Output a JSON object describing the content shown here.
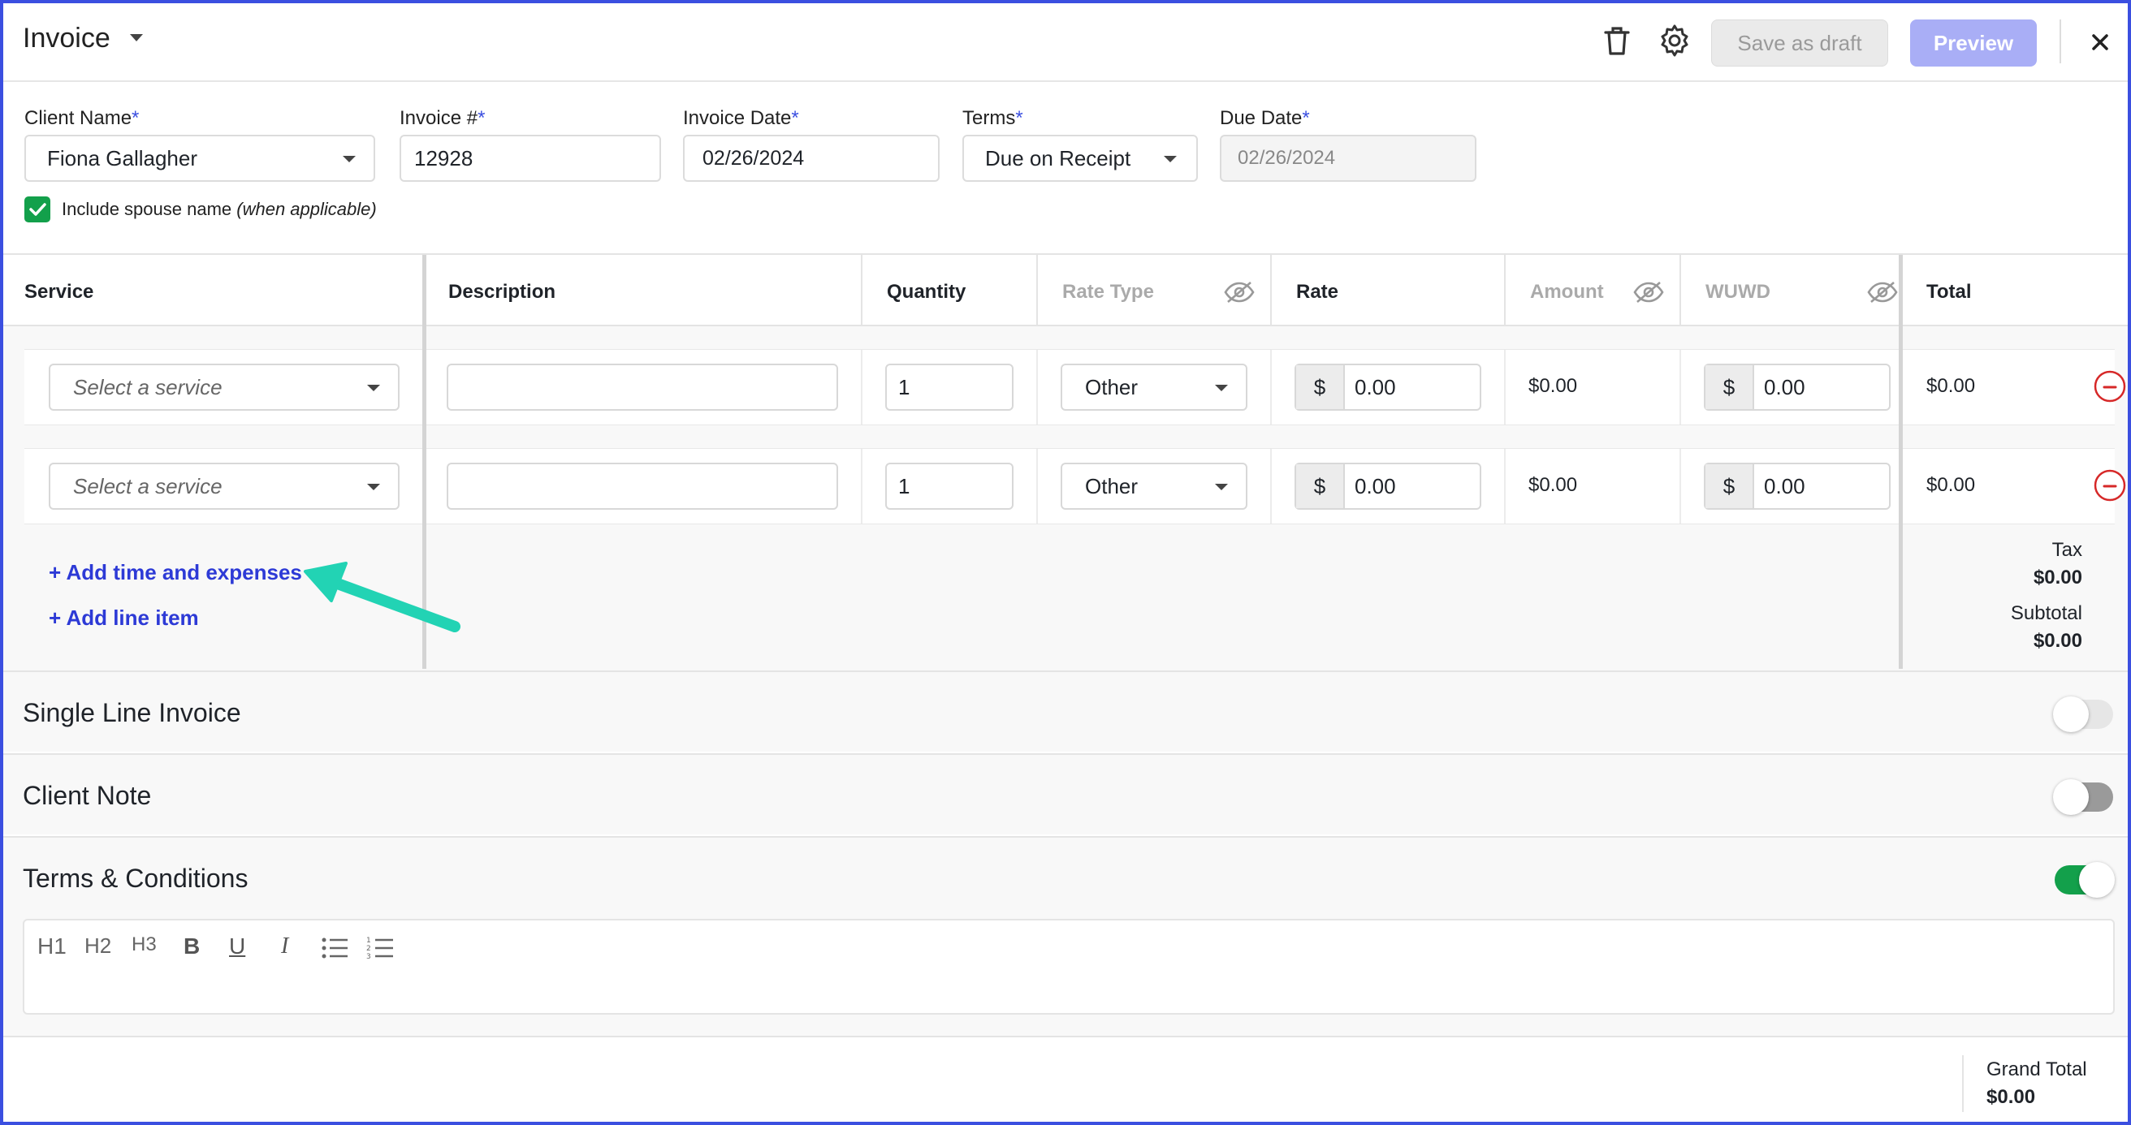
{
  "header": {
    "title": "Invoice",
    "save_draft_label": "Save as draft",
    "preview_label": "Preview",
    "icons": [
      "trash-icon",
      "gear-icon",
      "close-icon"
    ]
  },
  "form": {
    "client_name": {
      "label": "Client Name",
      "required": "*",
      "value": "Fiona Gallagher"
    },
    "invoice_number": {
      "label": "Invoice #",
      "required": "*",
      "value": "12928"
    },
    "invoice_date": {
      "label": "Invoice Date",
      "required": "*",
      "value": "02/26/2024"
    },
    "terms": {
      "label": "Terms",
      "required": "*",
      "value": "Due on Receipt"
    },
    "due_date": {
      "label": "Due Date",
      "required": "*",
      "value": "02/26/2024"
    },
    "include_spouse": {
      "label": "Include spouse name",
      "note": "(when applicable)",
      "checked": true
    }
  },
  "table": {
    "columns": [
      "Service",
      "Description",
      "Quantity",
      "Rate Type",
      "Rate",
      "Amount",
      "WUWD",
      "Total"
    ],
    "rows": [
      {
        "service_placeholder": "Select a service",
        "description": "",
        "quantity": "1",
        "rate_type": "Other",
        "rate_prefix": "$",
        "rate": "0.00",
        "amount": "$0.00",
        "wuwd_prefix": "$",
        "wuwd": "0.00",
        "total": "$0.00"
      },
      {
        "service_placeholder": "Select a service",
        "description": "",
        "quantity": "1",
        "rate_type": "Other",
        "rate_prefix": "$",
        "rate": "0.00",
        "amount": "$0.00",
        "wuwd_prefix": "$",
        "wuwd": "0.00",
        "total": "$0.00"
      }
    ],
    "add_time_label": "+ Add time and expenses",
    "add_line_label": "+ Add line item",
    "tax_label": "Tax",
    "tax_value": "$0.00",
    "subtotal_label": "Subtotal",
    "subtotal_value": "$0.00"
  },
  "sections": [
    {
      "title": "Single Line Invoice",
      "toggle_on": false
    },
    {
      "title": "Client Note",
      "toggle_on": false
    },
    {
      "title": "Terms & Conditions",
      "toggle_on": true
    }
  ],
  "editor_toolbar": {
    "h1": "H1",
    "h2": "H2",
    "h3": "H3",
    "bold": "B",
    "underline": "U",
    "italic": "I"
  },
  "footer": {
    "grand_total_label": "Grand Total",
    "grand_total_value": "$0.00"
  },
  "colors": {
    "accent": "#2d3ad6",
    "preview_button": "#a9aef6",
    "toggle_on": "#13a04b",
    "remove": "#d62828",
    "annotation_arrow": "#22d3b4"
  }
}
